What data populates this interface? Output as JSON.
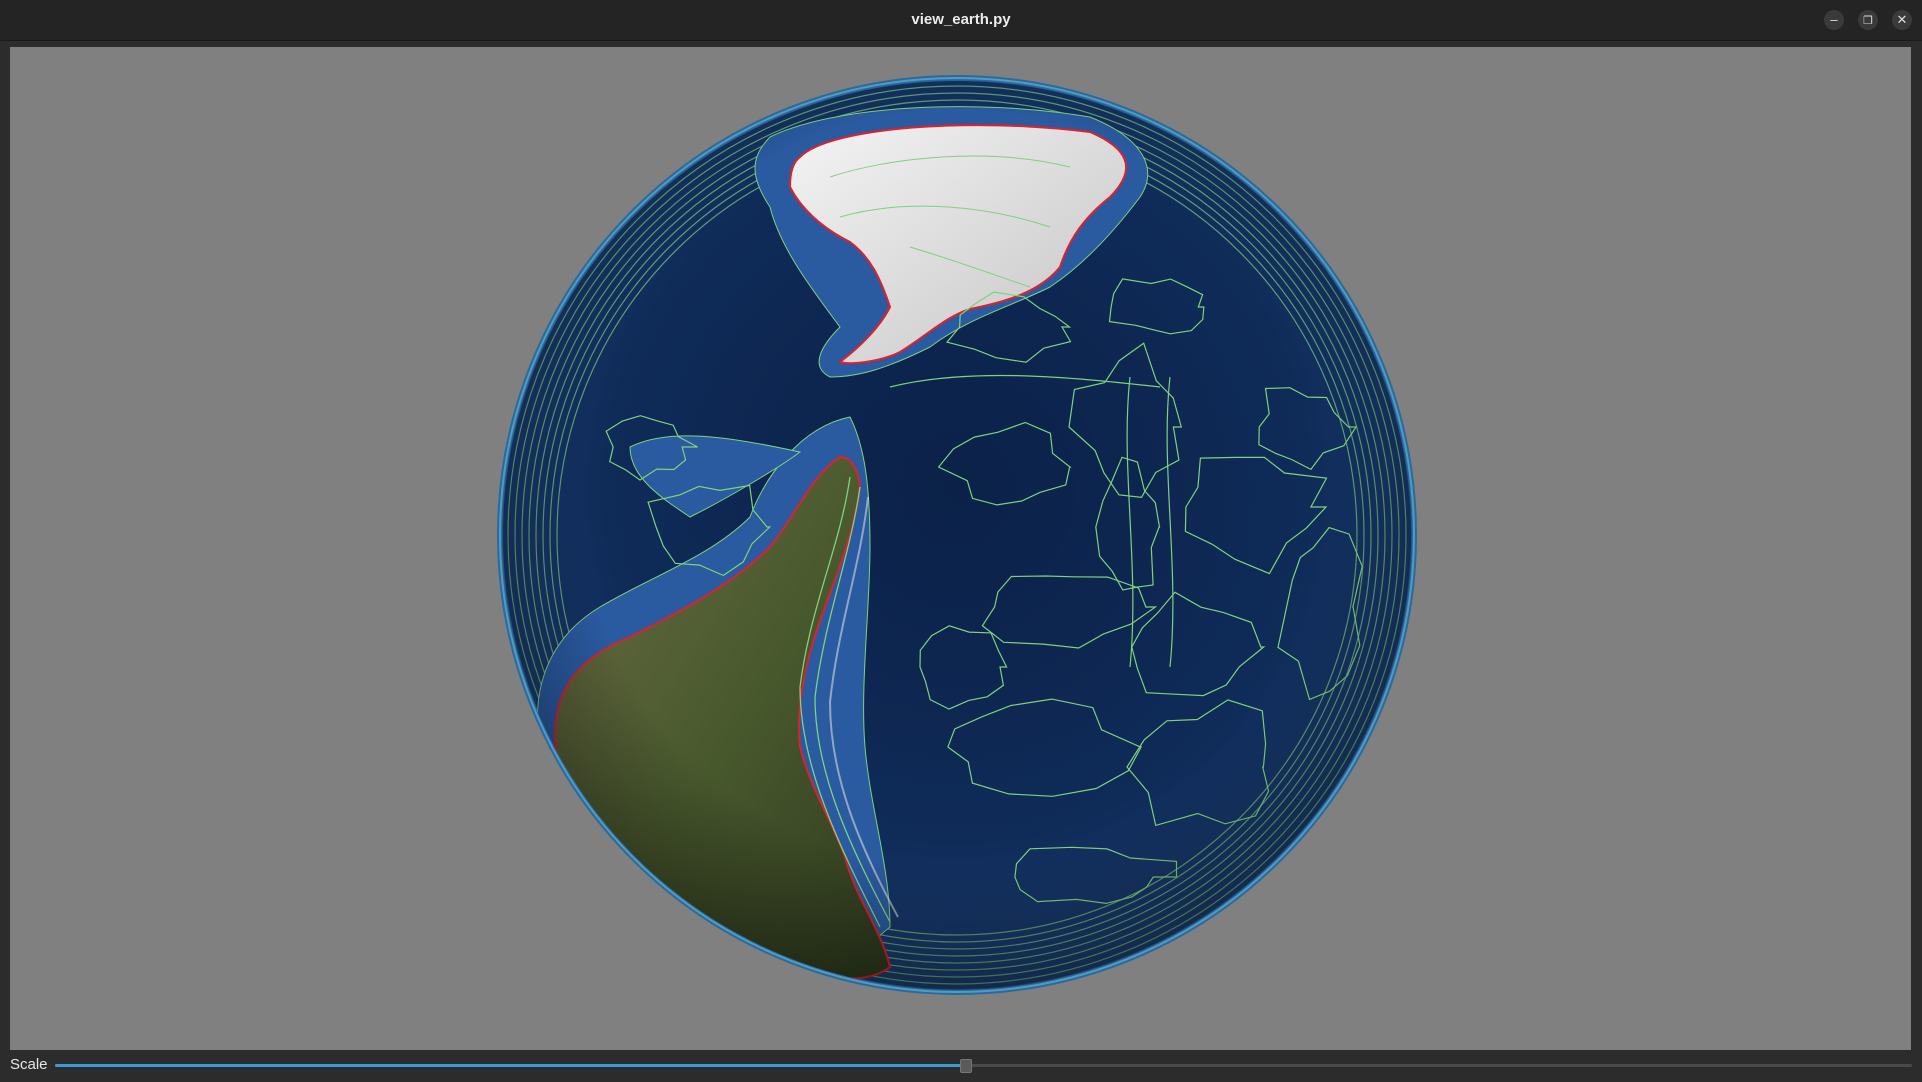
{
  "window": {
    "title": "view_earth.py",
    "controls": {
      "minimize_icon": "minimize-icon",
      "maximize_icon": "maximize-icon",
      "close_icon": "close-icon"
    }
  },
  "viewport": {
    "background_color": "#808080",
    "content": "3D globe rendering with bathymetry contours"
  },
  "controls": {
    "scale_label": "Scale",
    "scale_value_fraction": 0.49,
    "accent_color": "#3c9ad8"
  },
  "colors": {
    "ocean": "#0d2550",
    "shelf": "#2a5aa0",
    "land": "#4a5a2e",
    "ice": "#e6e6e6",
    "contour": "#7fd17f",
    "coastline": "#e0202a"
  }
}
